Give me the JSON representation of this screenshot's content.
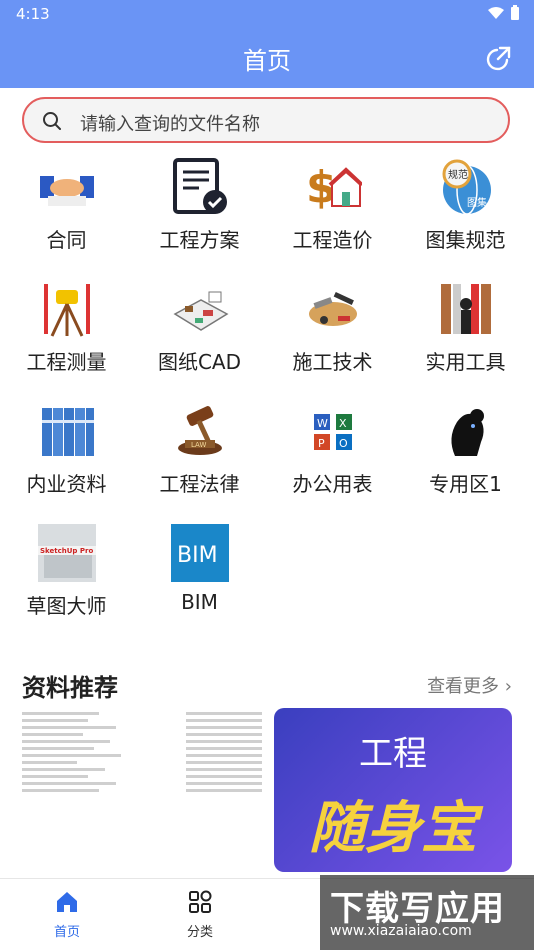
{
  "status": {
    "time": "4:13"
  },
  "header": {
    "title": "首页"
  },
  "search": {
    "placeholder": "请输入查询的文件名称"
  },
  "grid": [
    {
      "label": "合同",
      "icon": "handshake-icon"
    },
    {
      "label": "工程方案",
      "icon": "document-check-icon"
    },
    {
      "label": "工程造价",
      "icon": "money-house-icon"
    },
    {
      "label": "图集规范",
      "icon": "atlas-globe-icon"
    },
    {
      "label": "工程测量",
      "icon": "survey-tripod-icon"
    },
    {
      "label": "图纸CAD",
      "icon": "floorplan-icon"
    },
    {
      "label": "施工技术",
      "icon": "tools-icon"
    },
    {
      "label": "实用工具",
      "icon": "toolbox-icon"
    },
    {
      "label": "内业资料",
      "icon": "binders-icon"
    },
    {
      "label": "工程法律",
      "icon": "gavel-icon"
    },
    {
      "label": "办公用表",
      "icon": "office-apps-icon"
    },
    {
      "label": "专用区1",
      "icon": "thinking-head-icon"
    },
    {
      "label": "草图大师",
      "icon": "sketchup-icon"
    },
    {
      "label": "BIM",
      "icon": "bim-icon"
    }
  ],
  "recommend": {
    "title": "资料推荐",
    "more": "查看更多",
    "promo_line1": "工程",
    "promo_line2": "随身宝"
  },
  "tabs": [
    {
      "label": "首页",
      "active": true
    },
    {
      "label": "分类",
      "active": false
    }
  ],
  "watermark": {
    "title": "下载写应用",
    "url": "www.xiazaiaiao.com"
  },
  "colors": {
    "primary": "#6a94f5",
    "accent": "#2f6be8",
    "search_border": "#e35d5d"
  }
}
